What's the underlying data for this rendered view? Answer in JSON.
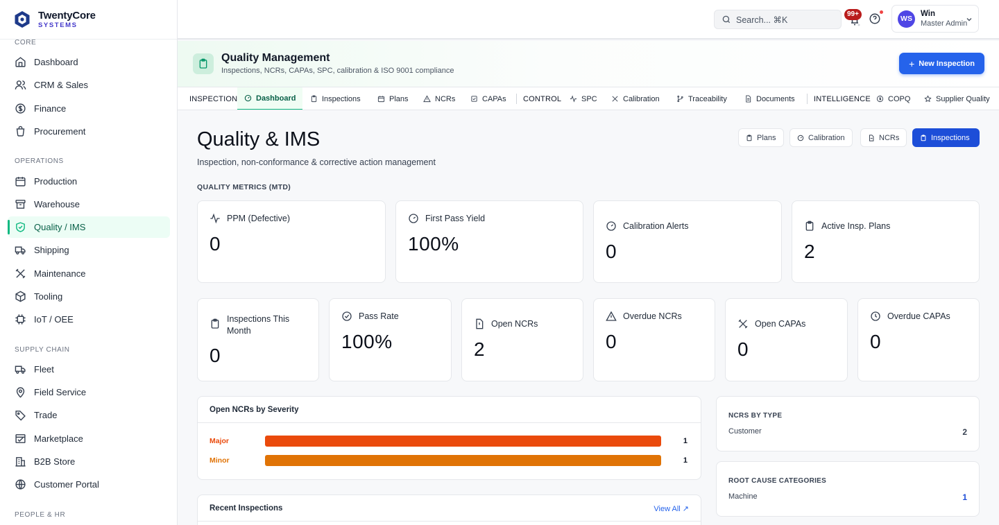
{
  "brand": {
    "name": "TwentyCore",
    "sub": "SYSTEMS"
  },
  "sidebar": {
    "sections": [
      {
        "label": "CORE",
        "items": [
          {
            "label": "Dashboard",
            "icon": "home-icon"
          },
          {
            "label": "CRM & Sales",
            "icon": "users-icon"
          },
          {
            "label": "Finance",
            "icon": "dollar-icon"
          },
          {
            "label": "Procurement",
            "icon": "cart-icon"
          }
        ]
      },
      {
        "label": "OPERATIONS",
        "items": [
          {
            "label": "Production",
            "icon": "calendar-icon"
          },
          {
            "label": "Warehouse",
            "icon": "warehouse-icon"
          },
          {
            "label": "Quality / IMS",
            "icon": "shield-check-icon",
            "active": true
          },
          {
            "label": "Shipping",
            "icon": "truck-icon"
          },
          {
            "label": "Maintenance",
            "icon": "wrench-icon"
          },
          {
            "label": "Tooling",
            "icon": "box-icon"
          },
          {
            "label": "IoT / OEE",
            "icon": "chip-icon"
          }
        ]
      },
      {
        "label": "SUPPLY CHAIN",
        "items": [
          {
            "label": "Fleet",
            "icon": "truck-icon"
          },
          {
            "label": "Field Service",
            "icon": "map-pin-icon"
          },
          {
            "label": "Trade",
            "icon": "tag-icon"
          },
          {
            "label": "Marketplace",
            "icon": "store-icon"
          },
          {
            "label": "B2B Store",
            "icon": "building-icon"
          },
          {
            "label": "Customer Portal",
            "icon": "globe-icon"
          }
        ]
      },
      {
        "label": "PEOPLE & HR",
        "items": []
      }
    ]
  },
  "topbar": {
    "search_placeholder": "Search... ⌘K",
    "notif_badge": "99+",
    "user": {
      "initials": "WS",
      "name": "Win",
      "role": "Master Admin"
    }
  },
  "module": {
    "title": "Quality Management",
    "subtitle": "Inspections, NCRs, CAPAs, SPC, calibration & ISO 9001 compliance",
    "new_button": "New Inspection"
  },
  "tabs": [
    {
      "label": "INSPECTION",
      "group": true
    },
    {
      "label": "Dashboard",
      "icon": "gauge-icon",
      "active": true
    },
    {
      "label": "Inspections",
      "icon": "clipboard-icon"
    },
    {
      "label": "Plans",
      "icon": "calendar-icon"
    },
    {
      "label": "NCRs",
      "icon": "alert-triangle-icon"
    },
    {
      "label": "CAPAs",
      "icon": "check-square-icon"
    },
    {
      "label": "CONTROL",
      "group": true
    },
    {
      "label": "SPC",
      "icon": "activity-icon"
    },
    {
      "label": "Calibration",
      "icon": "tools-icon"
    },
    {
      "label": "Traceability",
      "icon": "git-branch-icon"
    },
    {
      "label": "Documents",
      "icon": "file-text-icon"
    },
    {
      "label": "INTELLIGENCE",
      "group": true
    },
    {
      "label": "COPQ",
      "icon": "dollar-circle-icon"
    },
    {
      "label": "Supplier Quality",
      "icon": "star-icon"
    }
  ],
  "page": {
    "title": "Quality & IMS",
    "subtitle": "Inspection, non-conformance & corrective action management",
    "quick_buttons": [
      {
        "label": "Plans",
        "icon": "clipboard-icon"
      },
      {
        "label": "Calibration",
        "icon": "gauge-icon"
      },
      {
        "label": "NCRs",
        "icon": "file-icon"
      },
      {
        "label": "Inspections",
        "icon": "clipboard-icon",
        "primary": true
      }
    ],
    "metrics_label": "QUALITY METRICS (MTD)"
  },
  "metrics_top": [
    {
      "label": "PPM (Defective)",
      "value": "0",
      "icon": "activity-icon"
    },
    {
      "label": "First Pass Yield",
      "value": "100%",
      "icon": "gauge-icon"
    },
    {
      "label": "Calibration Alerts",
      "value": "0",
      "icon": "gauge-icon"
    },
    {
      "label": "Active Insp. Plans",
      "value": "2",
      "icon": "clipboard-icon"
    }
  ],
  "metrics_bottom": [
    {
      "label": "Inspections This Month",
      "value": "0",
      "icon": "clipboard-icon"
    },
    {
      "label": "Pass Rate",
      "value": "100%",
      "icon": "check-circle-icon"
    },
    {
      "label": "Open NCRs",
      "value": "2",
      "icon": "file-alert-icon"
    },
    {
      "label": "Overdue NCRs",
      "value": "0",
      "icon": "alert-triangle-icon"
    },
    {
      "label": "Open CAPAs",
      "value": "0",
      "icon": "tools-icon"
    },
    {
      "label": "Overdue CAPAs",
      "value": "0",
      "icon": "clock-icon"
    }
  ],
  "severity_panel": {
    "title": "Open NCRs by Severity",
    "rows": [
      {
        "label": "Major",
        "count": "1",
        "fraction": 1.0,
        "color": "#ea4a0c"
      },
      {
        "label": "Minor",
        "count": "1",
        "fraction": 1.0,
        "color": "#e07306"
      }
    ]
  },
  "ncr_types": {
    "title": "NCRS BY TYPE",
    "rows": [
      {
        "label": "Customer",
        "value": "2"
      }
    ]
  },
  "root_causes": {
    "title": "ROOT CAUSE CATEGORIES",
    "rows": [
      {
        "label": "Machine",
        "value": "1"
      }
    ]
  },
  "recent": {
    "title": "Recent Inspections",
    "view_all": "View All ↗"
  },
  "colors": {
    "accent": "#10b981",
    "primary": "#2563eb",
    "major": "#ea4a0c",
    "minor": "#e07306"
  }
}
